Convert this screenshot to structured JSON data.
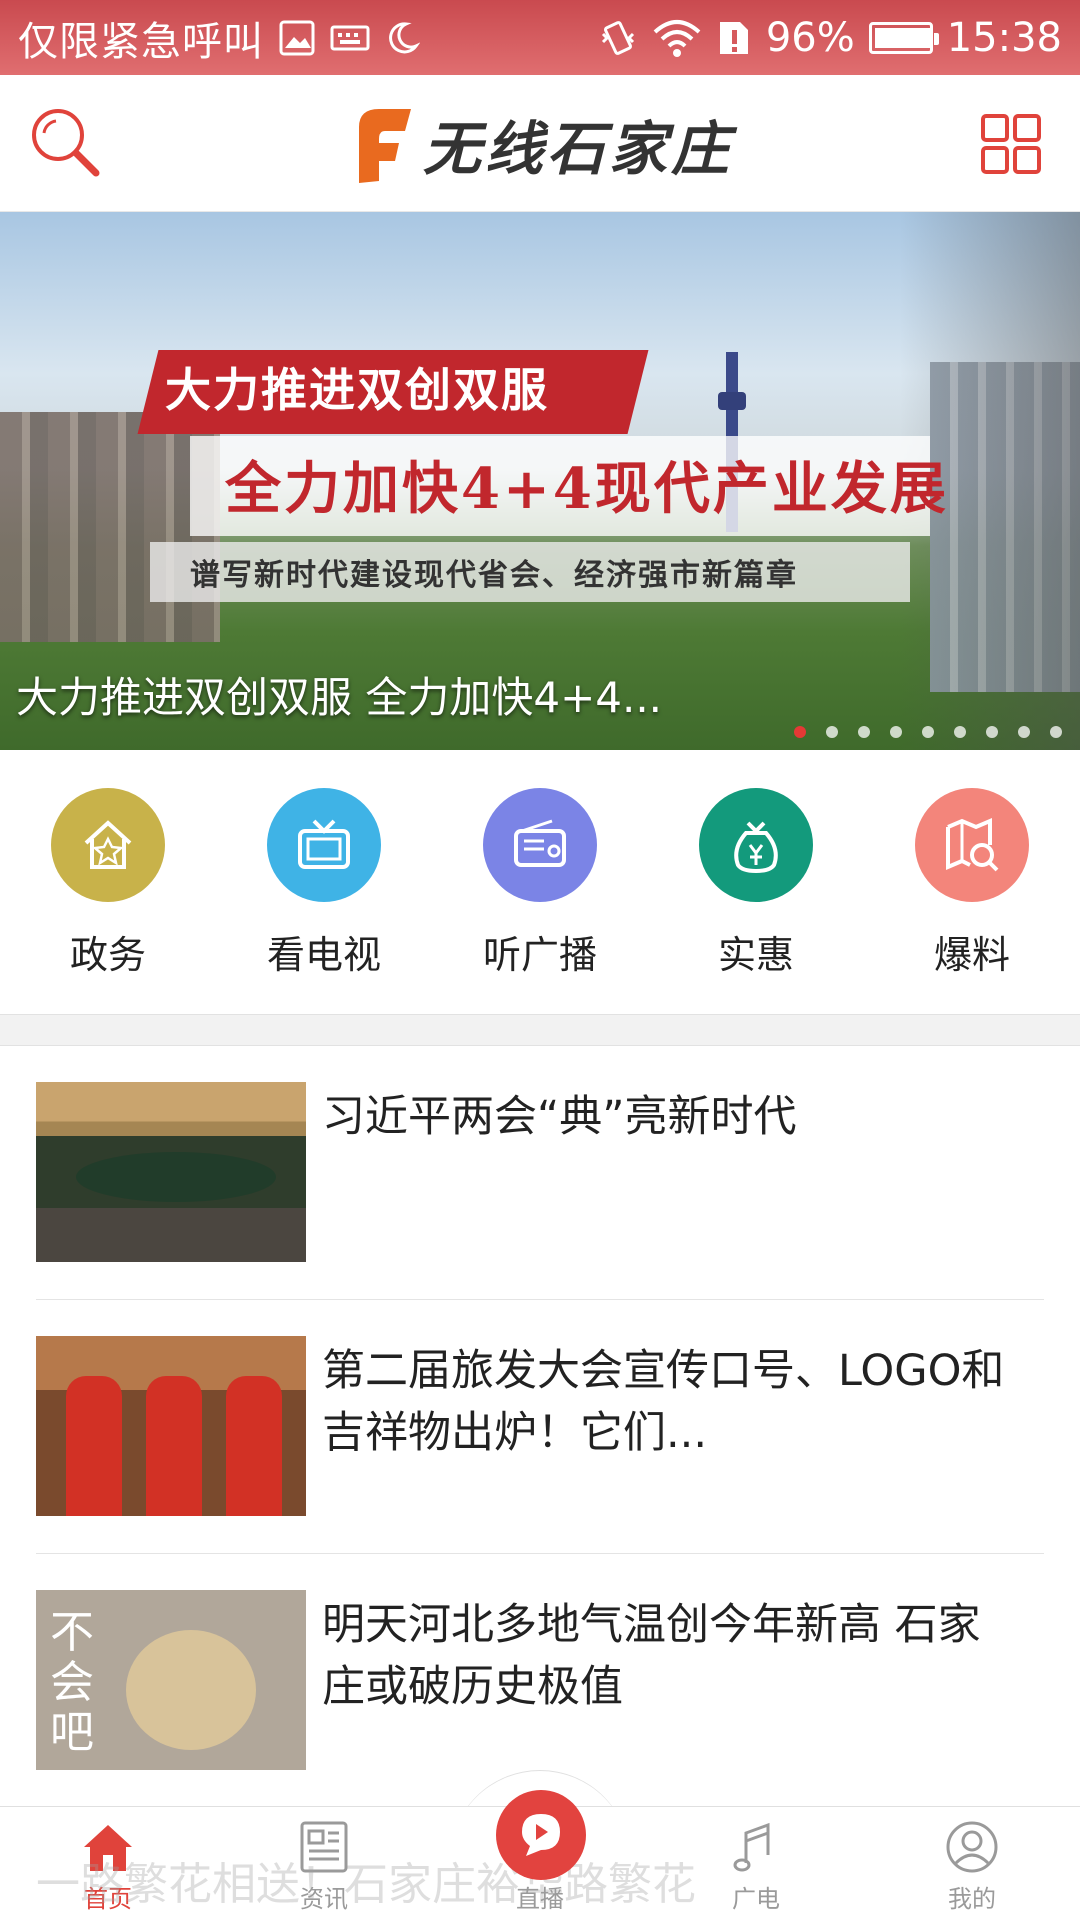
{
  "status_bar": {
    "carrier": "仅限紧急呼叫",
    "battery": "96%",
    "time": "15:38",
    "battery_level": 0.96
  },
  "header": {
    "logo_text": "无线石家庄"
  },
  "banner": {
    "red_title": "大力推进双创双服",
    "main_title": "全力加快4+4现代产业发展",
    "subtitle": "谱写新时代建设现代省会、经济强市新篇章",
    "caption": "大力推进双创双服 全力加快4+4...",
    "dot_count": 9,
    "active_dot": 0
  },
  "categories": [
    {
      "label": "政务",
      "icon": "home-star-icon",
      "color": "#c8b24a"
    },
    {
      "label": "看电视",
      "icon": "tv-icon",
      "color": "#3fb3e6"
    },
    {
      "label": "听广播",
      "icon": "radio-icon",
      "color": "#7b84e6"
    },
    {
      "label": "实惠",
      "icon": "money-bag-icon",
      "color": "#139a7c"
    },
    {
      "label": "爆料",
      "icon": "map-search-icon",
      "color": "#f3857b"
    }
  ],
  "news": [
    {
      "title": "习近平两会“典”亮新时代"
    },
    {
      "title": "第二届旅发大会宣传口号、LOGO和吉祥物出炉！它们..."
    },
    {
      "title": "明天河北多地气温创今年新高 石家庄或破历史极值",
      "thumb_text": "不会吧"
    }
  ],
  "ticker": "一路繁花相送！石家庄裕华路繁花",
  "bottom_nav": [
    {
      "label": "首页",
      "icon": "home-icon",
      "active": true
    },
    {
      "label": "资讯",
      "icon": "news-icon",
      "active": false
    },
    {
      "label": "直播",
      "icon": "live-icon",
      "active": false
    },
    {
      "label": "广电",
      "icon": "music-note-icon",
      "active": false
    },
    {
      "label": "我的",
      "icon": "user-icon",
      "active": false
    }
  ],
  "colors": {
    "brand_red": "#e0433b",
    "status_bar": "#d65a5d"
  }
}
